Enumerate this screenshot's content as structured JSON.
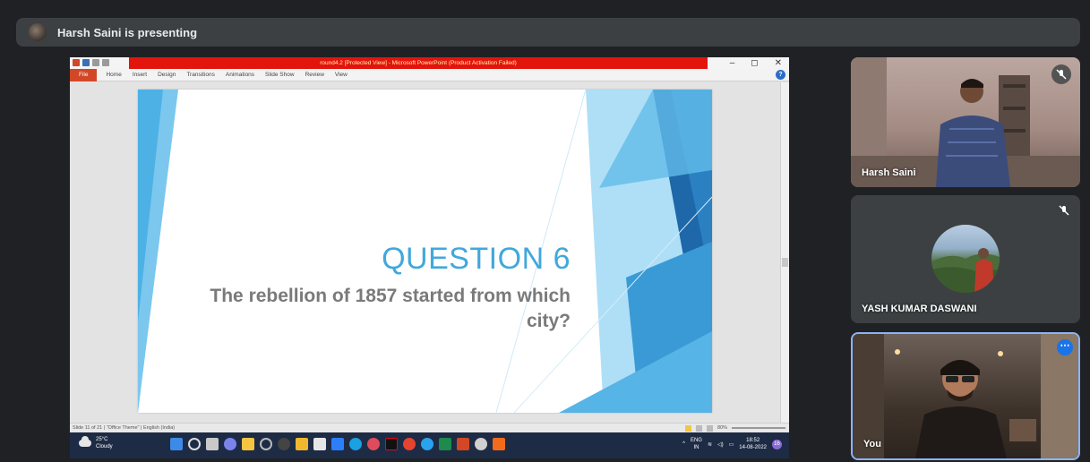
{
  "presenter_bar": {
    "text": "Harsh Saini is presenting"
  },
  "powerpoint": {
    "title_bar": "round4.2 [Protected View] - Microsoft PowerPoint (Product Activation Failed)",
    "window_controls": [
      "–",
      "◻",
      "✕"
    ],
    "ribbon_tabs": [
      "File",
      "Home",
      "Insert",
      "Design",
      "Transitions",
      "Animations",
      "Slide Show",
      "Review",
      "View"
    ],
    "help_label": "?",
    "slide": {
      "title": "QUESTION 6",
      "subtitle": "The rebellion of 1857 started from which city?"
    },
    "status_bar": {
      "slide_info": "Slide 11 of 21",
      "theme": "\"Office Theme\"",
      "language": "English (India)",
      "zoom": "80%"
    }
  },
  "taskbar": {
    "weather_temp": "25°C",
    "weather_desc": "Cloudy",
    "lang_1": "ENG",
    "lang_2": "IN",
    "time": "18:52",
    "date": "14-08-2022",
    "notif_count": "16"
  },
  "participants": [
    {
      "name": "Harsh Saini"
    },
    {
      "name": "YASH KUMAR DASWANI"
    },
    {
      "name": "You"
    }
  ],
  "colors": {
    "slide_title": "#41a8dc",
    "tile_highlight": "#8ab4f8",
    "background": "#202124"
  }
}
